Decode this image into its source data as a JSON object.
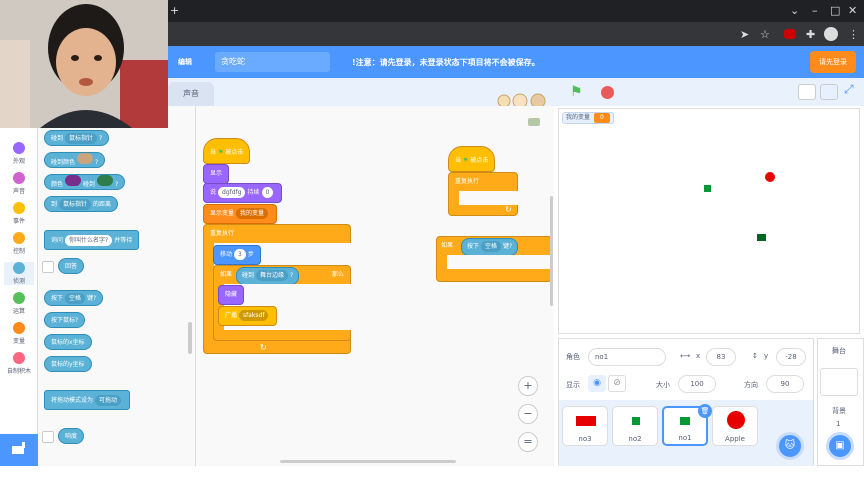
{
  "menubar": {
    "edit": "编辑",
    "project_title": "贪吃蛇",
    "notice": "!注意：请先登录，未登录状态下项目将不会被保存。",
    "login": "请先登录"
  },
  "tabs": {
    "sounds": "声音"
  },
  "categories": [
    {
      "label": "外观",
      "color": "#9966ff"
    },
    {
      "label": "声音",
      "color": "#cf63cf"
    },
    {
      "label": "事件",
      "color": "#ffbf00"
    },
    {
      "label": "控制",
      "color": "#ffab19"
    },
    {
      "label": "侦测",
      "color": "#5cb1d6"
    },
    {
      "label": "运算",
      "color": "#59c059"
    },
    {
      "label": "变量",
      "color": "#ff8c1a"
    },
    {
      "label": "自制积木",
      "color": "#ff6680"
    }
  ],
  "palette": {
    "touching": "碰到",
    "touching_opt": "鼠标指针",
    "q": "?",
    "touch_color": "碰到颜色",
    "color_touch": "颜色",
    "color_touch2": "碰到",
    "distance": "到",
    "distance_opt": "鼠标指针",
    "distance_end": "的距离",
    "ask": "询问",
    "ask_text": "你叫什么名字?",
    "ask_end": "并等待",
    "answer": "回答",
    "key": "按下",
    "key_opt": "空格",
    "key_end": "键?",
    "mouse_down": "按下鼠标?",
    "mouse_x": "鼠标的x坐标",
    "mouse_y": "鼠标的y坐标",
    "drag": "将拖动模式设为",
    "drag_opt": "可拖动",
    "loudness": "响度"
  },
  "script1": {
    "hat": "当",
    "hat_end": "被点击",
    "show": "显示",
    "say": "说",
    "say_text": "dgfdfg",
    "say_mid": "持续",
    "say_secs": "0",
    "setvar": "显示变量",
    "setvar_opt": "我的变量",
    "forever": "重复执行",
    "move": "移动",
    "move_n": "3",
    "move_end": "步",
    "if": "如果",
    "touch": "碰到",
    "touch_opt": "舞台边缘",
    "q": "?",
    "then": "那么",
    "hide": "隐藏",
    "broadcast": "广播",
    "broadcast_opt": "sfaksdf"
  },
  "script2": {
    "hat": "当",
    "hat_end": "被点击",
    "forever": "重复执行"
  },
  "script3": {
    "if": "如果",
    "key": "按下",
    "key_opt": "空格",
    "key_end": "键?"
  },
  "stage": {
    "var_name": "我的变量",
    "var_value": "0"
  },
  "sprite_info": {
    "sprite_label": "角色",
    "sprite_name": "no1",
    "x_label": "x",
    "x_value": "83",
    "y_label": "y",
    "y_value": "-28",
    "show_label": "显示",
    "size_label": "大小",
    "size_value": "100",
    "dir_label": "方向",
    "dir_value": "90"
  },
  "sprites": [
    {
      "name": "no3",
      "color": "#e60000"
    },
    {
      "name": "no2",
      "color": "#009933"
    },
    {
      "name": "no1",
      "color": "#009933"
    },
    {
      "name": "Apple",
      "color": "#e60000"
    }
  ],
  "stage_panel": {
    "label": "舞台",
    "backdrop_label": "背景",
    "backdrop_count": "1"
  },
  "zoom": {
    "in": "+",
    "out": "−",
    "reset": "="
  }
}
